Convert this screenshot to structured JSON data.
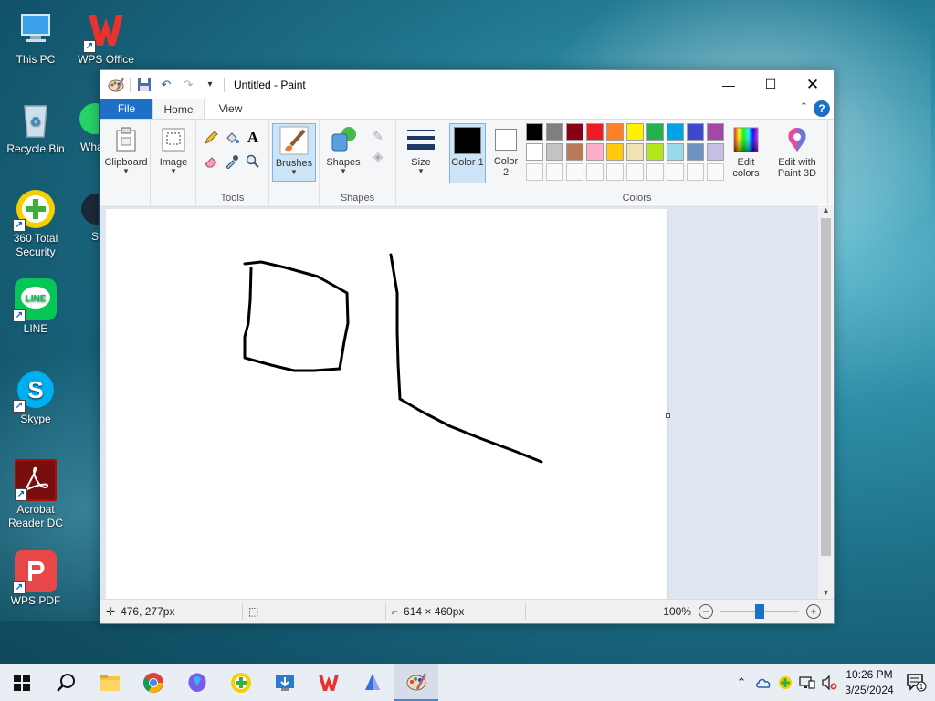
{
  "desktop": {
    "icons": [
      {
        "label": "This PC"
      },
      {
        "label": "WPS Office"
      },
      {
        "label": "Recycle Bin"
      },
      {
        "label": "Wha"
      },
      {
        "label": "360 Total Security"
      },
      {
        "label": "St"
      },
      {
        "label": "LINE"
      },
      {
        "label": "Skype"
      },
      {
        "label": "Acrobat Reader DC"
      },
      {
        "label": "WPS PDF"
      }
    ]
  },
  "window": {
    "title": "Untitled - Paint",
    "tabs": {
      "file": "File",
      "home": "Home",
      "view": "View"
    },
    "help": "?",
    "ribbon": {
      "clipboard": "Clipboard",
      "image": "Image",
      "tools": "Tools",
      "brushes": "Brushes",
      "shapes": "Shapes",
      "shapes_group": "Shapes",
      "size": "Size",
      "color1": "Color 1",
      "color1_num": "1",
      "color2": "Color",
      "color2_num": "2",
      "edit_colors": "Edit colors",
      "edit_paint3d": "Edit with Paint 3D",
      "colors_group": "Colors"
    },
    "palette_row1": [
      "#000000",
      "#7f7f7f",
      "#880015",
      "#ed1c24",
      "#ff7f27",
      "#fff200",
      "#22b14c",
      "#00a2e8",
      "#3f48cc",
      "#a349a4"
    ],
    "palette_row2": [
      "#ffffff",
      "#c3c3c3",
      "#b97a57",
      "#ffaec9",
      "#ffc90e",
      "#efe4b0",
      "#b5e61d",
      "#99d9ea",
      "#7092be",
      "#c8bfe7"
    ],
    "status": {
      "cursor_pos": "476, 277px",
      "canvas_size": "614 × 460px",
      "zoom": "100%"
    }
  },
  "taskbar": {
    "time": "10:26 PM",
    "date": "3/25/2024",
    "notif_count": "1"
  }
}
